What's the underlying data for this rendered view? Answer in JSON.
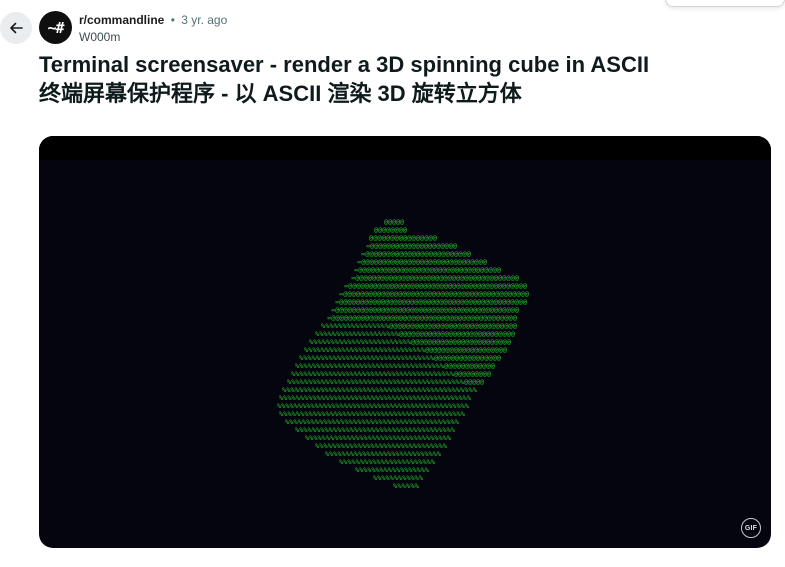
{
  "post": {
    "subreddit": "r/commandline",
    "separator": "•",
    "time_ago": "3 yr. ago",
    "author": "W000m",
    "avatar_text": "~#",
    "title_en": "Terminal screensaver - render a 3D spinning cube in ASCII",
    "title_zh": "终端屏幕保护程序 - 以 ASCII 渲染 3D 旋转立方体"
  },
  "media": {
    "type": "gif",
    "badge": "GIF",
    "background_color": "#05050f",
    "ascii_color": "#22c02a",
    "ascii_faces": [
      {
        "name": "top-face",
        "char": "@",
        "edge_char": "=",
        "side_char": "|"
      },
      {
        "name": "front-face",
        "char": "%",
        "edge_char": "~"
      }
    ]
  },
  "icons": {
    "back": "arrow-left-icon"
  },
  "colors": {
    "text_primary": "#0f1a1c",
    "text_secondary": "#576f76",
    "back_button_bg": "#eaedef",
    "avatar_bg": "#0f0f0f"
  }
}
